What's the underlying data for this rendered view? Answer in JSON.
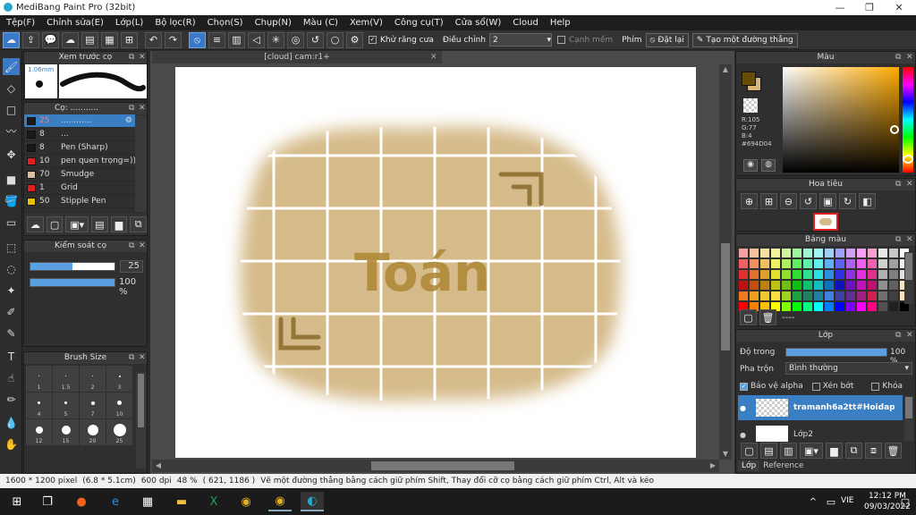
{
  "window": {
    "title": "MediBang Paint Pro (32bit)",
    "minimize": "—",
    "maximize": "❐",
    "close": "✕"
  },
  "menu": [
    "Tệp(F)",
    "Chỉnh sửa(E)",
    "Lớp(L)",
    "Bộ lọc(R)",
    "Chọn(S)",
    "Chụp(N)",
    "Màu (C)",
    "Xem(V)",
    "Công cụ(T)",
    "Cửa sổ(W)",
    "Cloud",
    "Help"
  ],
  "toolbar": {
    "antialias_label": "Khử răng cưa",
    "adjust_label": "Điều chỉnh",
    "adjust_value": "2",
    "edge_label": "Cạnh mềm",
    "key_label": "Phím",
    "reset_label": "Đặt lại",
    "line_label": "Tạo một đường thẳng"
  },
  "preview": {
    "title": "Xem trước cọ",
    "size": "1.06mm"
  },
  "brushes": {
    "title": "Cọ: ...........",
    "items": [
      {
        "size": "25",
        "name": "............",
        "color": "#1a1a1a",
        "selected": true
      },
      {
        "size": "8",
        "name": "...",
        "color": "#1a1a1a",
        "selected": false
      },
      {
        "size": "8",
        "name": "Pen (Sharp)",
        "color": "#1a1a1a",
        "selected": false
      },
      {
        "size": "10",
        "name": "pen quen trọng=)))",
        "color": "#e02020",
        "selected": false
      },
      {
        "size": "70",
        "name": "Smudge",
        "color": "#d8c0a0",
        "selected": false
      },
      {
        "size": "1",
        "name": "Grid",
        "color": "#e02020",
        "selected": false
      },
      {
        "size": "50",
        "name": "Stipple Pen",
        "color": "#e8c000",
        "selected": false
      }
    ]
  },
  "control": {
    "title": "Kiểm soát cọ",
    "size_value": "25",
    "opacity_value": "100 %",
    "size_fraction": 0.5,
    "opacity_fraction": 1.0
  },
  "brushsize": {
    "title": "Brush Size",
    "labels": [
      "1",
      "1.5",
      "2",
      "3",
      "4",
      "5",
      "7",
      "10",
      "12",
      "15",
      "20",
      "25"
    ]
  },
  "document": {
    "tab": "[cloud] cam:r1+",
    "canvas_text": "Toán"
  },
  "color": {
    "title": "Màu",
    "r": "R:105",
    "g": "G:77",
    "b": "B:4",
    "hex": "#694D04",
    "fg": "#694d04",
    "bg": "#d9b77a"
  },
  "navigator": {
    "title": "Hoa tiêu"
  },
  "palette": {
    "title": "Bảng màu",
    "name": "----",
    "colors": [
      "#f5a0a0",
      "#f5c0a0",
      "#f5e0a0",
      "#f5f5a0",
      "#d0f5a0",
      "#a0f5a0",
      "#a0f5d0",
      "#a0f5f5",
      "#a0d0f5",
      "#a0a0f5",
      "#d0a0f5",
      "#f5a0f5",
      "#f5a0d0",
      "#e8e8e8",
      "#c8c8c8",
      "#ffffff",
      "#f06060",
      "#f09060",
      "#f0c060",
      "#f0f060",
      "#b0f060",
      "#60f060",
      "#60f0b0",
      "#60f0f0",
      "#60b0f0",
      "#6060f0",
      "#b060f0",
      "#f060f0",
      "#f060b0",
      "#d0d0d0",
      "#a0a0a0",
      "#f0f0f0",
      "#e03030",
      "#e07030",
      "#e0a030",
      "#e0e030",
      "#90e030",
      "#30e030",
      "#30e090",
      "#30e0e0",
      "#3090e0",
      "#3030e0",
      "#9030e0",
      "#e030e0",
      "#e03090",
      "#b0b0b0",
      "#808080",
      "#e0e0e0",
      "#c01010",
      "#c05010",
      "#c08010",
      "#c0c010",
      "#70c010",
      "#10c010",
      "#10c070",
      "#10c0c0",
      "#1070c0",
      "#1010c0",
      "#7010c0",
      "#c010c0",
      "#c01070",
      "#909090",
      "#606060",
      "#f5e6c8",
      "#f07820",
      "#f0a020",
      "#f0c830",
      "#f8e040",
      "#a0d020",
      "#20a040",
      "#208060",
      "#2080a0",
      "#4080e0",
      "#4040a0",
      "#603090",
      "#a02080",
      "#d02050",
      "#707070",
      "#404040",
      "#ffe0c0",
      "#ff0000",
      "#ff8000",
      "#ffc000",
      "#ffff00",
      "#80ff00",
      "#00ff00",
      "#00ff80",
      "#00ffff",
      "#0080ff",
      "#0000ff",
      "#8000ff",
      "#ff00ff",
      "#ff0080",
      "#505050",
      "#202020",
      "#000000"
    ]
  },
  "layers": {
    "title": "Lớp",
    "opacity_label": "Độ trong",
    "opacity_value": "100 %",
    "blend_label": "Pha trộn",
    "blend_value": "Bình thường",
    "alpha_label": "Bảo vệ alpha",
    "clip_label": "Xén bớt",
    "lock_label": "Khóa",
    "items": [
      {
        "name": "tramanh6a2tt#Hoidap",
        "selected": true
      },
      {
        "name": "Lớp2",
        "selected": false
      }
    ],
    "tab_layer": "Lớp",
    "tab_reference": "Reference"
  },
  "status": {
    "size": "1600 * 1200 pixel",
    "cm": "(6.8 * 5.1cm)",
    "dpi": "600 dpi",
    "zoom": "48 %",
    "coords": "( 621, 1186 )",
    "hint": "Vẽ một đường thẳng bằng cách giữ phím Shift, Thay đổi cỡ cọ bằng cách giữ phím Ctrl, Alt và kéo"
  },
  "taskbar": {
    "lang": "VIE",
    "time": "12:12 PM",
    "date": "09/03/2022",
    "tray": "^"
  }
}
